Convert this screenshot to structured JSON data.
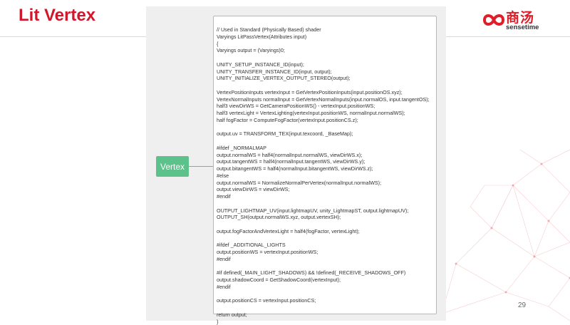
{
  "slide": {
    "title": "Lit Vertex",
    "page_number": "29"
  },
  "logo": {
    "chinese_text": "商汤",
    "english_text": "sensetime",
    "brand_color": "#e01e2a"
  },
  "diagram": {
    "node_label": "Vertex",
    "node_color": "#5cc18a"
  },
  "code": {
    "text": "// Used in Standard (Physically Based) shader\nVaryings LitPassVertex(Attributes input)\n{\nVaryings output = (Varyings)0;\n\nUNITY_SETUP_INSTANCE_ID(input);\nUNITY_TRANSFER_INSTANCE_ID(input, output);\nUNITY_INITIALIZE_VERTEX_OUTPUT_STEREO(output);\n\nVertexPositionInputs vertexInput = GetVertexPositionInputs(input.positionOS.xyz);\nVertexNormalInputs normalInput = GetVertexNormalInputs(input.normalOS, input.tangentOS);\nhalf3 viewDirWS = GetCameraPositionWS() - vertexInput.positionWS;\nhalf3 vertexLight = VertexLighting(vertexInput.positionWS, normalInput.normalWS);\nhalf fogFactor = ComputeFogFactor(vertexInput.positionCS.z);\n\noutput.uv = TRANSFORM_TEX(input.texcoord, _BaseMap);\n\n#ifdef _NORMALMAP\noutput.normalWS = half4(normalInput.normalWS, viewDirWS.x);\noutput.tangentWS = half4(normalInput.tangentWS, viewDirWS.y);\noutput.bitangentWS = half4(normalInput.bitangentWS, viewDirWS.z);\n#else\noutput.normalWS = NormalizeNormalPerVertex(normalInput.normalWS);\noutput.viewDirWS = viewDirWS;\n#endif\n\nOUTPUT_LIGHTMAP_UV(input.lightmapUV, unity_LightmapST, output.lightmapUV);\nOUTPUT_SH(output.normalWS.xyz, output.vertexSH);\n\noutput.fogFactorAndVertexLight = half4(fogFactor, vertexLight);\n\n#ifdef _ADDITIONAL_LIGHTS\noutput.positionWS = vertexInput.positionWS;\n#endif\n\n#if defined(_MAIN_LIGHT_SHADOWS) && !defined(_RECEIVE_SHADOWS_OFF)\noutput.shadowCoord = GetShadowCoord(vertexInput);\n#endif\n\noutput.positionCS = vertexInput.positionCS;\n\nreturn output;\n}"
  },
  "colors": {
    "title": "#d2162c",
    "panel": "#efefef",
    "code_border": "#b8b8b8"
  }
}
